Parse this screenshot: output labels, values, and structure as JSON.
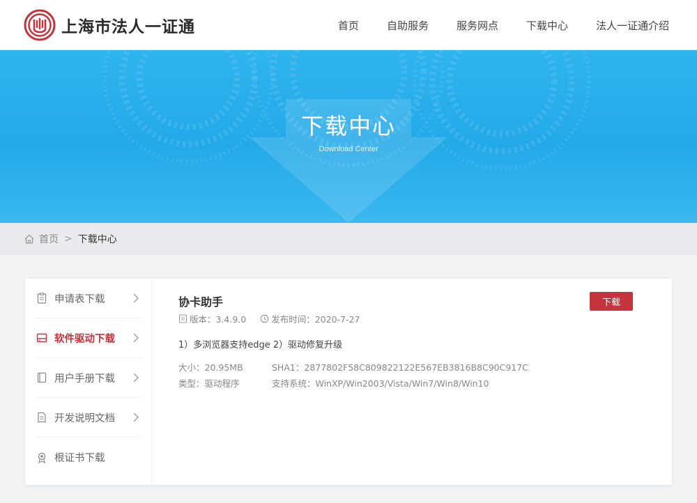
{
  "header": {
    "logo_text": "上海市法人一证通",
    "nav": [
      "首页",
      "自助服务",
      "服务网点",
      "下载中心",
      "法人一证通介绍"
    ]
  },
  "banner": {
    "title": "下载中心",
    "subtitle": "Download Center"
  },
  "breadcrumb": {
    "home": "首页",
    "separator": ">",
    "current": "下载中心"
  },
  "sidebar": {
    "items": [
      {
        "label": "申请表下载",
        "icon": "clipboard-icon",
        "active": false
      },
      {
        "label": "软件驱动下载",
        "icon": "drive-icon",
        "active": true
      },
      {
        "label": "用户手册下载",
        "icon": "book-icon",
        "active": false
      },
      {
        "label": "开发说明文档",
        "icon": "document-icon",
        "active": false
      },
      {
        "label": "根证书下载",
        "icon": "certificate-icon",
        "active": false
      }
    ]
  },
  "product": {
    "title": "协卡助手",
    "version": "版本：3.4.9.0",
    "release": "发布时间：2020-7-27",
    "description": "1）多浏览器支持edge 2）驱动修复升级",
    "size": "大小：20.95MB",
    "sha1": "SHA1：2877802F58C809822122E567EB3816B8C90C917C",
    "type": "类型：驱动程序",
    "os": "支持系统：WinXP/Win2003/Vista/Win7/Win8/Win10",
    "download_label": "下载"
  },
  "colors": {
    "accent": "#c5333d",
    "banner": "#2aaeea"
  }
}
